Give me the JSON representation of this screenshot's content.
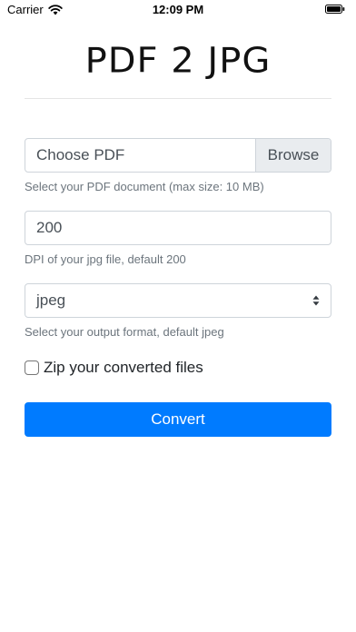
{
  "status_bar": {
    "carrier": "Carrier",
    "time": "12:09 PM",
    "wifi_icon": "wifi-icon",
    "battery_icon": "battery-icon"
  },
  "app": {
    "title": "PDF 2 JPG"
  },
  "file_input": {
    "label": "Choose PDF",
    "browse_label": "Browse",
    "help": "Select your PDF document (max size: 10 MB)"
  },
  "dpi_input": {
    "value": "200",
    "help": "DPI of your jpg file, default 200"
  },
  "format_select": {
    "selected": "jpeg",
    "help": "Select your output format, default jpeg",
    "arrows_icon": "select-arrows-icon"
  },
  "zip_option": {
    "checked": false,
    "label": "Zip your converted files"
  },
  "convert_button": {
    "label": "Convert"
  },
  "colors": {
    "primary": "#007bff",
    "border": "#ced4da",
    "muted_text": "#6c757d",
    "addon_background": "#e9ecef"
  }
}
